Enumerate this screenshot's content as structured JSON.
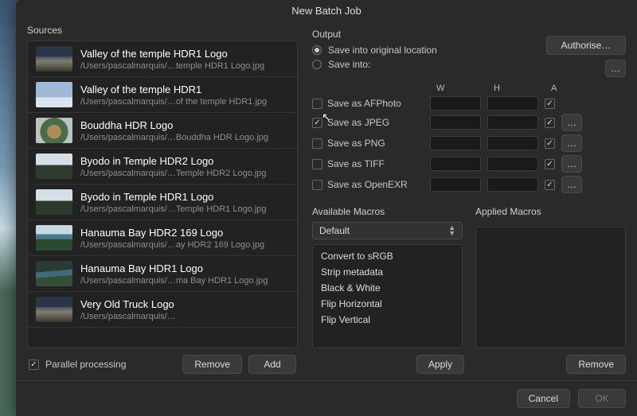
{
  "title": "New Batch Job",
  "sources_label": "Sources",
  "sources": [
    {
      "title": "Valley of the temple HDR1 Logo",
      "path": "/Users/pascalmarquis/…temple HDR1 Logo.jpg",
      "thumb": "sky"
    },
    {
      "title": "Valley of the temple HDR1",
      "path": "/Users/pascalmarquis/…of the temple HDR1.jpg",
      "thumb": "sky2"
    },
    {
      "title": "Bouddha HDR Logo",
      "path": "/Users/pascalmarquis/…Bouddha HDR Logo.jpg",
      "thumb": "bud"
    },
    {
      "title": "Byodo in Temple HDR2 Logo",
      "path": "/Users/pascalmarquis/…Temple HDR2 Logo.jpg",
      "thumb": "temple"
    },
    {
      "title": "Byodo in Temple HDR1 Logo",
      "path": "/Users/pascalmarquis/…Temple HDR1 Logo.jpg",
      "thumb": "temple"
    },
    {
      "title": "Hanauma Bay HDR2 169 Logo",
      "path": "/Users/pascalmarquis/…ay HDR2 169 Logo.jpg",
      "thumb": "bay"
    },
    {
      "title": "Hanauma Bay HDR1 Logo",
      "path": "/Users/pascalmarquis/…ma Bay HDR1 Logo.jpg",
      "thumb": "bay2"
    },
    {
      "title": "Very Old Truck Logo",
      "path": "/Users/pascalmarquis/…",
      "thumb": "sky"
    }
  ],
  "parallel_label": "Parallel processing",
  "parallel_checked": true,
  "remove_btn": "Remove",
  "add_btn": "Add",
  "output_label": "Output",
  "save_original": "Save into original location",
  "save_into": "Save into:",
  "authorise": "Authorise…",
  "more": "…",
  "col_w": "W",
  "col_h": "H",
  "col_a": "A",
  "formats": [
    {
      "label": "Save as AFPhoto",
      "checked": false,
      "a": true,
      "more": false
    },
    {
      "label": "Save as JPEG",
      "checked": true,
      "a": true,
      "more": true
    },
    {
      "label": "Save as PNG",
      "checked": false,
      "a": true,
      "more": true
    },
    {
      "label": "Save as TIFF",
      "checked": false,
      "a": true,
      "more": true
    },
    {
      "label": "Save as OpenEXR",
      "checked": false,
      "a": true,
      "more": true
    }
  ],
  "available_macros_label": "Available Macros",
  "applied_macros_label": "Applied Macros",
  "macro_group": "Default",
  "macros": [
    "Convert to sRGB",
    "Strip metadata",
    "Black & White",
    "Flip Horizontal",
    "Flip Vertical"
  ],
  "apply_btn": "Apply",
  "remove_macro_btn": "Remove",
  "cancel_btn": "Cancel",
  "ok_btn": "OK"
}
